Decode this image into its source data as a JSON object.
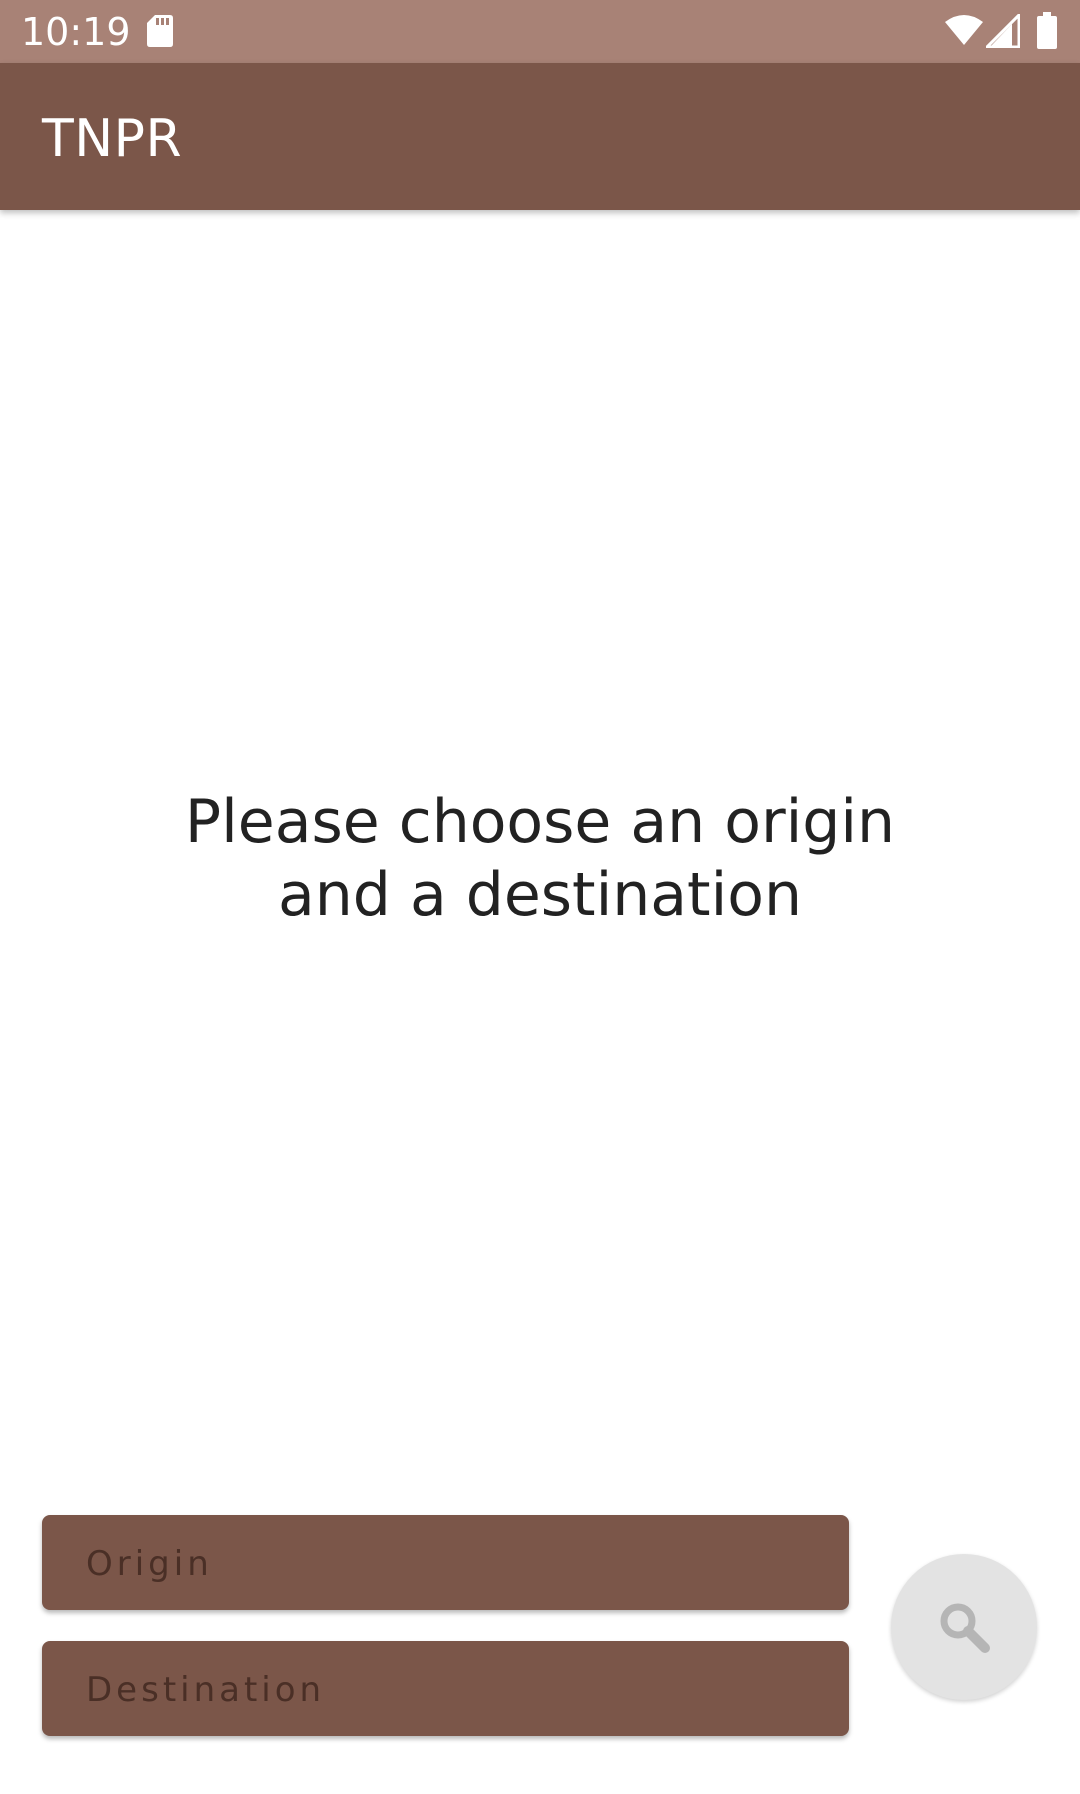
{
  "status_bar": {
    "time": "10:19",
    "icons": [
      "sd-card-icon",
      "wifi-icon",
      "signal-icon",
      "battery-icon"
    ]
  },
  "app_bar": {
    "title": "TNPR"
  },
  "main": {
    "prompt": "Please choose an origin and a destination"
  },
  "form": {
    "origin_label": "Origin",
    "destination_label": "Destination",
    "search_button_icon": "search-icon"
  },
  "colors": {
    "status_bar": "#a88276",
    "primary": "#7b5649",
    "field_text": "#4a2f26",
    "fab_background": "#e3e3e3",
    "fab_icon": "#b5b5b5"
  }
}
